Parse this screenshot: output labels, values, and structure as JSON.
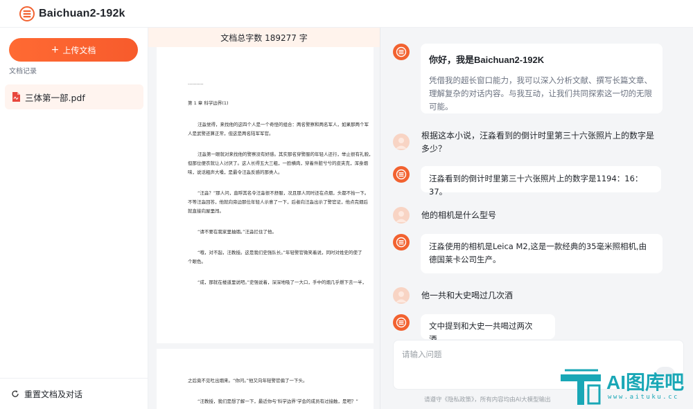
{
  "header": {
    "app_title": "Baichuan2-192k",
    "logo_icon": "baichuan-logo-icon"
  },
  "sidebar": {
    "upload_label": "上传文档",
    "history_label": "文档记录",
    "files": [
      {
        "name": "三体第一部.pdf",
        "icon": "pdf-file-icon"
      }
    ],
    "reset_label": "重置文档及对话"
  },
  "document": {
    "header": "文档总字数 189277 字",
    "page1": {
      "dots": "...........",
      "chapter": "第 1 章  科学边界(1)",
      "paragraphs": [
        [
          "汪淼觉得，来找他的这四个人是一个奇怪的组合：两名警察和两名军人，如果那两个军",
          "人是武警还算正常，但这是两名陆军军官。"
        ],
        [
          "汪淼第一眼就对来找他的警察没有好感。其实那名穿警服的年轻人还行，举止很有礼貌，",
          "但那位便衣就让人讨厌了。这人长得五大三粗，一脸横肉，穿着件脏兮兮的皮夹克，浑身烟",
          "味，说话粗声大嗓，是最令汪淼反感的那类人。"
        ],
        [
          "“汪淼？”那人问，直呼其名令汪淼很不舒服，况且那人同时还在点烟，头都不抬一下。",
          "不等汪淼回答，他就向旁边那位年轻人示意了一下，后者向汪淼出示了警官证，他点完烟后",
          "就直接向屋里闯。"
        ],
        [
          "“请不要在我家里抽烟。”汪淼拦住了他。"
        ],
        [
          "“哦，对不起，汪教授。这是我们史强队长。”年轻警官微笑着说，同时对姓史的使了",
          "个眼色。"
        ],
        [
          "“成，那就在楼道里说吧。”史强说着，深深地吸了一大口，手中的烟几乎燃下去一半，"
        ]
      ]
    },
    "page2": {
      "lines": [
        "之后竟不见吐出烟来。“你问。”他又向年轻警官偏了一下头。",
        "“汪教授，我们是想了解一下，最近你与‘科学边界’学会的成员有过接触，是吧？”"
      ]
    }
  },
  "chat": {
    "messages": [
      {
        "role": "bot",
        "title": "你好，我是Baichuan2-192K",
        "text": "凭借我的超长窗口能力，我可以深入分析文献、撰写长篇文章、理解复杂的对话内容。与我互动，让我们共同探索这一切的无限可能。"
      },
      {
        "role": "user",
        "text": "根据这本小说，汪淼看到的倒计时里第三十六张照片上的数字是多少？"
      },
      {
        "role": "bot",
        "text": "汪淼看到的倒计时里第三十六张照片上的数字是1194：16：37。"
      },
      {
        "role": "user",
        "text": "他的相机是什么型号"
      },
      {
        "role": "bot",
        "text": "汪淼使用的相机是Leica M2,这是一款经典的35毫米照相机,由德国莱卡公司生产。"
      },
      {
        "role": "user",
        "text": "他一共和大史喝过几次酒"
      },
      {
        "role": "bot",
        "text": "文中提到和大史一共喝过两次酒。"
      }
    ],
    "input_placeholder": "请输入问题",
    "disclaimer": "请遵守《隐私政策》，所有内容均由AI大模型输出"
  },
  "watermark": {
    "text": "AI图库吧",
    "url": "www.aituku.cc"
  },
  "colors": {
    "accent": "#f75b2c",
    "bot_avatar": "#f26230",
    "user_avatar": "#f8d4c4",
    "watermark": "#19a7b6"
  }
}
